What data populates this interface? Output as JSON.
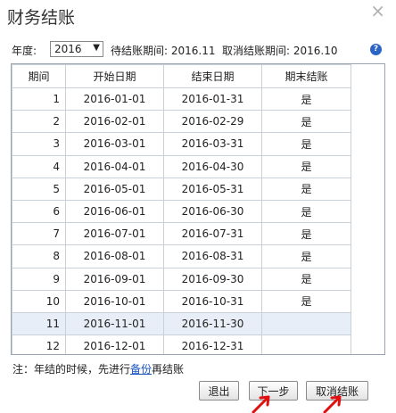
{
  "dialog": {
    "title": "财务结账",
    "close_glyph": "×"
  },
  "filter": {
    "year_label": "年度:",
    "year_value": "2016",
    "pending_text": "待结账期间: 2016.11",
    "cancel_text": "取消结账期间: 2016.10",
    "help_glyph": "?"
  },
  "table": {
    "headers": [
      "期间",
      "开始日期",
      "结束日期",
      "期末结账"
    ],
    "rows": [
      {
        "period": "1",
        "start": "2016-01-01",
        "end": "2016-01-31",
        "closed": "是"
      },
      {
        "period": "2",
        "start": "2016-02-01",
        "end": "2016-02-29",
        "closed": "是"
      },
      {
        "period": "3",
        "start": "2016-03-01",
        "end": "2016-03-31",
        "closed": "是"
      },
      {
        "period": "4",
        "start": "2016-04-01",
        "end": "2016-04-30",
        "closed": "是"
      },
      {
        "period": "5",
        "start": "2016-05-01",
        "end": "2016-05-31",
        "closed": "是"
      },
      {
        "period": "6",
        "start": "2016-06-01",
        "end": "2016-06-30",
        "closed": "是"
      },
      {
        "period": "7",
        "start": "2016-07-01",
        "end": "2016-07-31",
        "closed": "是"
      },
      {
        "period": "8",
        "start": "2016-08-01",
        "end": "2016-08-31",
        "closed": "是"
      },
      {
        "period": "9",
        "start": "2016-09-01",
        "end": "2016-09-30",
        "closed": "是"
      },
      {
        "period": "10",
        "start": "2016-10-01",
        "end": "2016-10-31",
        "closed": "是"
      },
      {
        "period": "11",
        "start": "2016-11-01",
        "end": "2016-11-30",
        "closed": ""
      },
      {
        "period": "12",
        "start": "2016-12-01",
        "end": "2016-12-31",
        "closed": ""
      }
    ],
    "selected_period": "11"
  },
  "note": {
    "prefix": "注：年结的时候，先进行",
    "link": "备份",
    "suffix": "再结账"
  },
  "buttons": {
    "exit": "退出",
    "next": "下一步",
    "cancel_close": "取消结账"
  },
  "annotation_color": "#e01010"
}
